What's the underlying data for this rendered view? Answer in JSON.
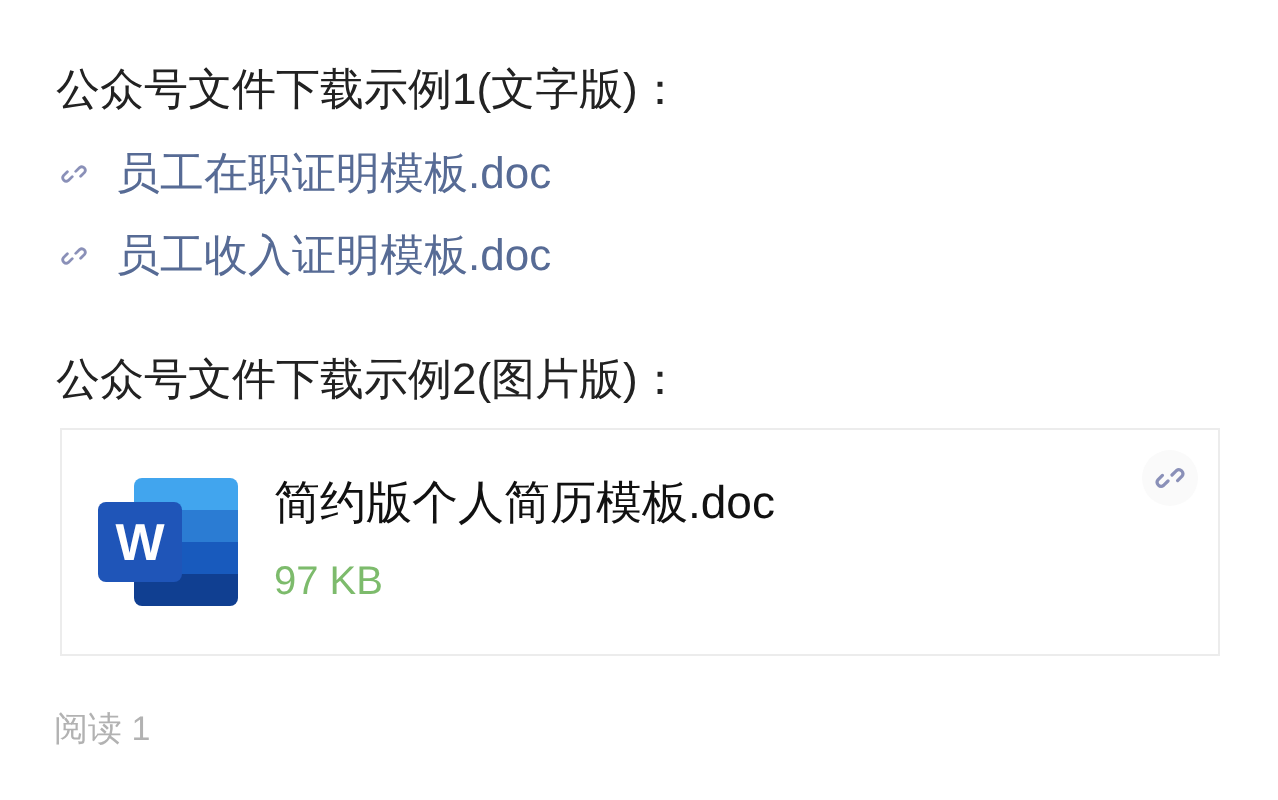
{
  "sections": [
    {
      "heading": "公众号文件下载示例1(文字版)：",
      "kind": "links",
      "links": [
        "员工在职证明模板.doc",
        "员工收入证明模板.doc"
      ]
    },
    {
      "heading": "公众号文件下载示例2(图片版)：",
      "kind": "file",
      "file": {
        "icon_letter": "W",
        "name": "简约版个人简历模板.doc",
        "size": "97 KB"
      }
    }
  ],
  "footer": {
    "reads": "阅读 1"
  }
}
